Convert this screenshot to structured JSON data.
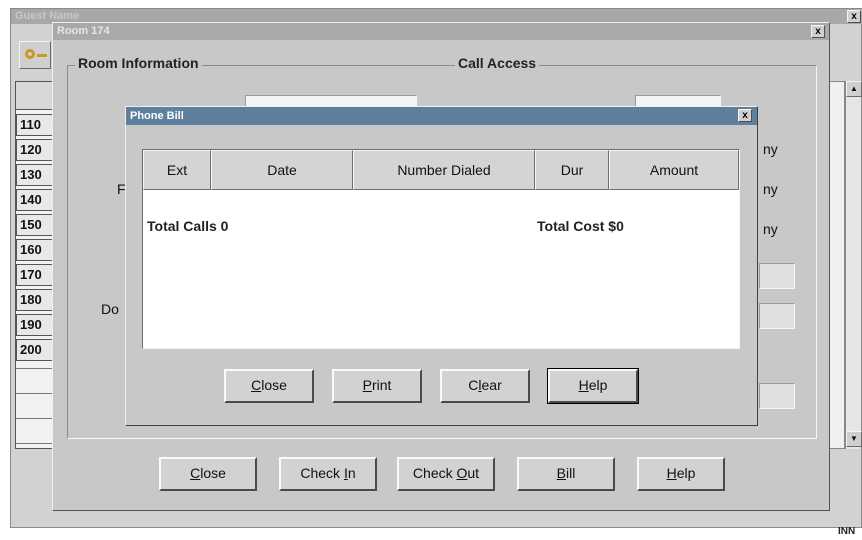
{
  "guest_window": {
    "title": "Guest Name",
    "room_numbers": [
      "110",
      "120",
      "130",
      "140",
      "150",
      "160",
      "170",
      "180",
      "190",
      "200"
    ],
    "corner_label": "INN"
  },
  "room_dialog": {
    "title": "Room 174",
    "close_glyph": "x",
    "room_info_title": "Room Information",
    "call_access_title": "Call Access",
    "partial_labels": [
      "F",
      "Do"
    ],
    "right_partial_labels": [
      "ny",
      "ny",
      "ny"
    ],
    "buttons": {
      "close": {
        "pre": "",
        "u": "C",
        "post": "lose"
      },
      "check_in": {
        "pre": "Check ",
        "u": "I",
        "post": "n"
      },
      "check_out": {
        "pre": "Check ",
        "u": "O",
        "post": "ut"
      },
      "bill": {
        "pre": "",
        "u": "B",
        "post": "ill"
      },
      "help": {
        "pre": "",
        "u": "H",
        "post": "elp"
      }
    }
  },
  "phone_bill": {
    "title": "Phone Bill",
    "close_glyph": "x",
    "columns": [
      "Ext",
      "Date",
      "Number Dialed",
      "Dur",
      "Amount"
    ],
    "total_calls": "Total Calls 0",
    "total_cost": "Total Cost $0",
    "buttons": {
      "close": {
        "pre": "",
        "u": "C",
        "post": "lose"
      },
      "print": {
        "pre": "",
        "u": "P",
        "post": "rint"
      },
      "clear": {
        "pre": "C",
        "u": "l",
        "post": "ear"
      },
      "help": {
        "pre": "",
        "u": "H",
        "post": "elp"
      }
    }
  },
  "colors": {
    "titlebar_active": "#5f7f9e",
    "titlebar_inactive": "#a8a8a8",
    "dialog_face": "#c8c8c8"
  }
}
